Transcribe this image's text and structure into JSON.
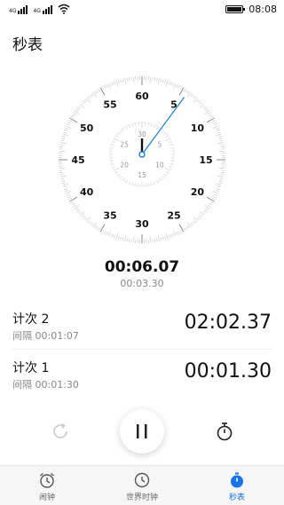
{
  "status_bar": {
    "network_1": "4G",
    "network_2": "4G",
    "time": "08:08"
  },
  "header": {
    "title": "秒表"
  },
  "dial": {
    "outer_labels": [
      "60",
      "5",
      "10",
      "15",
      "20",
      "25",
      "30",
      "35",
      "40",
      "45",
      "50",
      "55"
    ],
    "inner_labels": [
      "30",
      "5",
      "10",
      "15",
      "20",
      "25"
    ],
    "accent_color": "#1a7fd0"
  },
  "stopwatch": {
    "total_time": "00:06.07",
    "lap_time": "00:03.30"
  },
  "laps": [
    {
      "label": "计次 2",
      "interval": "间隔 00:01:07",
      "time": "02:02.37"
    },
    {
      "label": "计次 1",
      "interval": "间隔 00:01:30",
      "time": "00:01.30"
    }
  ],
  "controls": {
    "reset_icon": "reset-icon",
    "pause_icon": "pause-icon",
    "lap_icon": "stopwatch-icon"
  },
  "nav": {
    "items": [
      {
        "label": "闹钟",
        "icon": "alarm-icon"
      },
      {
        "label": "世界时钟",
        "icon": "world-clock-icon"
      },
      {
        "label": "秒表",
        "icon": "stopwatch-icon",
        "active": true
      }
    ],
    "active_color": "#1a73e8"
  }
}
